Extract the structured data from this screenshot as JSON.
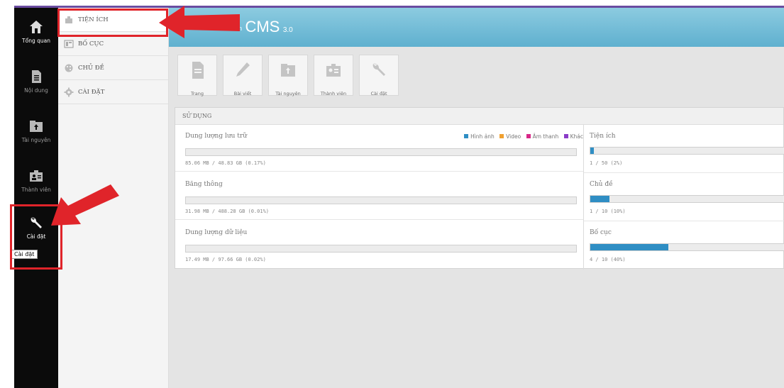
{
  "nav": {
    "items": [
      {
        "label": "Tổng quan",
        "icon": "home-icon"
      },
      {
        "label": "Nội dung",
        "icon": "document-icon"
      },
      {
        "label": "Tài nguyên",
        "icon": "folder-icon"
      },
      {
        "label": "Thành viên",
        "icon": "members-icon"
      },
      {
        "label": "Cài đặt",
        "icon": "wrench-icon"
      }
    ],
    "tooltip": "Cài đặt"
  },
  "submenu": {
    "items": [
      {
        "label": "TIỆN ÍCH",
        "icon": "puzzle-icon"
      },
      {
        "label": "BỐ CỤC",
        "icon": "layout-icon"
      },
      {
        "label": "CHỦ ĐỀ",
        "icon": "palette-icon"
      },
      {
        "label": "CÀI ĐẶT",
        "icon": "gear-icon"
      }
    ]
  },
  "header": {
    "logo_prefix": "vnvn",
    "logo_name": "CMS",
    "logo_version": "3.0"
  },
  "toolbar": {
    "items": [
      {
        "label": "Trang",
        "icon": "page-icon"
      },
      {
        "label": "Bài viết",
        "icon": "pencil-icon"
      },
      {
        "label": "Tài nguyên",
        "icon": "folder-icon"
      },
      {
        "label": "Thành viên",
        "icon": "members-icon"
      },
      {
        "label": "Cài đặt",
        "icon": "wrench-icon"
      }
    ]
  },
  "usage": {
    "title": "SỬ DỤNG",
    "legend": [
      {
        "label": "Hình ảnh",
        "color": "#2f8ec4"
      },
      {
        "label": "Video",
        "color": "#f0a030"
      },
      {
        "label": "Âm thanh",
        "color": "#d82888"
      },
      {
        "label": "Khác",
        "color": "#8a3cc8"
      }
    ],
    "left": [
      {
        "label": "Dung lượng lưu trữ",
        "value": "85.06 MB / 48.83 GB (0.17%)"
      },
      {
        "label": "Băng thông",
        "value": "31.98 MB / 488.28 GB (0.01%)"
      },
      {
        "label": "Dung lượng dữ liệu",
        "value": "17.49 MB / 97.66 GB (0.02%)"
      }
    ],
    "right": [
      {
        "label": "Tiện ích",
        "value": "1 / 50 (2%)",
        "fraction": 0.02
      },
      {
        "label": "Chủ đề",
        "value": "1 / 10 (10%)",
        "fraction": 0.1
      },
      {
        "label": "Bố cục",
        "value": "4 / 10 (40%)",
        "fraction": 0.4
      }
    ]
  },
  "colors": {
    "annotation": "#e0242a",
    "header": "#6dbbd6",
    "bar_fill": "#2f8ec4"
  }
}
